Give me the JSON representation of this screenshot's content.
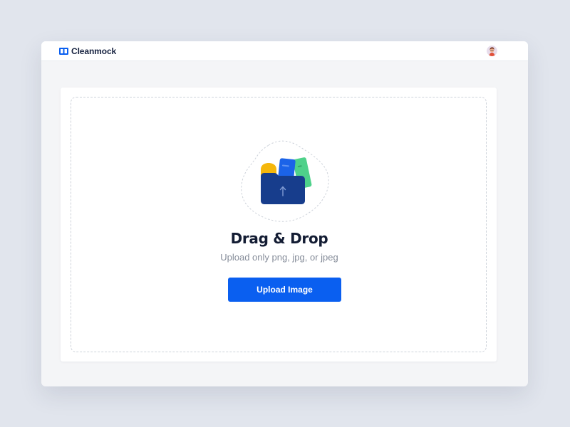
{
  "app": {
    "name": "Cleanmock",
    "logo_icon": "book-open-icon",
    "avatar_icon": "user-avatar"
  },
  "upload": {
    "title": "Drag & Drop",
    "subtitle": "Upload only png, jpg, or jpeg",
    "button_label": "Upload Image",
    "illustration_icon": "folder-upload-icon",
    "arrow_icon": "arrow-up-icon"
  },
  "colors": {
    "background": "#e1e5ed",
    "window": "#f4f5f7",
    "card": "#ffffff",
    "accent": "#0a5ff0",
    "heading": "#131c33",
    "muted": "#858c99",
    "folder": "#173d8c",
    "file_yellow": "#f5b70c",
    "file_blue": "#1b63e8",
    "file_green": "#4ed18a"
  }
}
